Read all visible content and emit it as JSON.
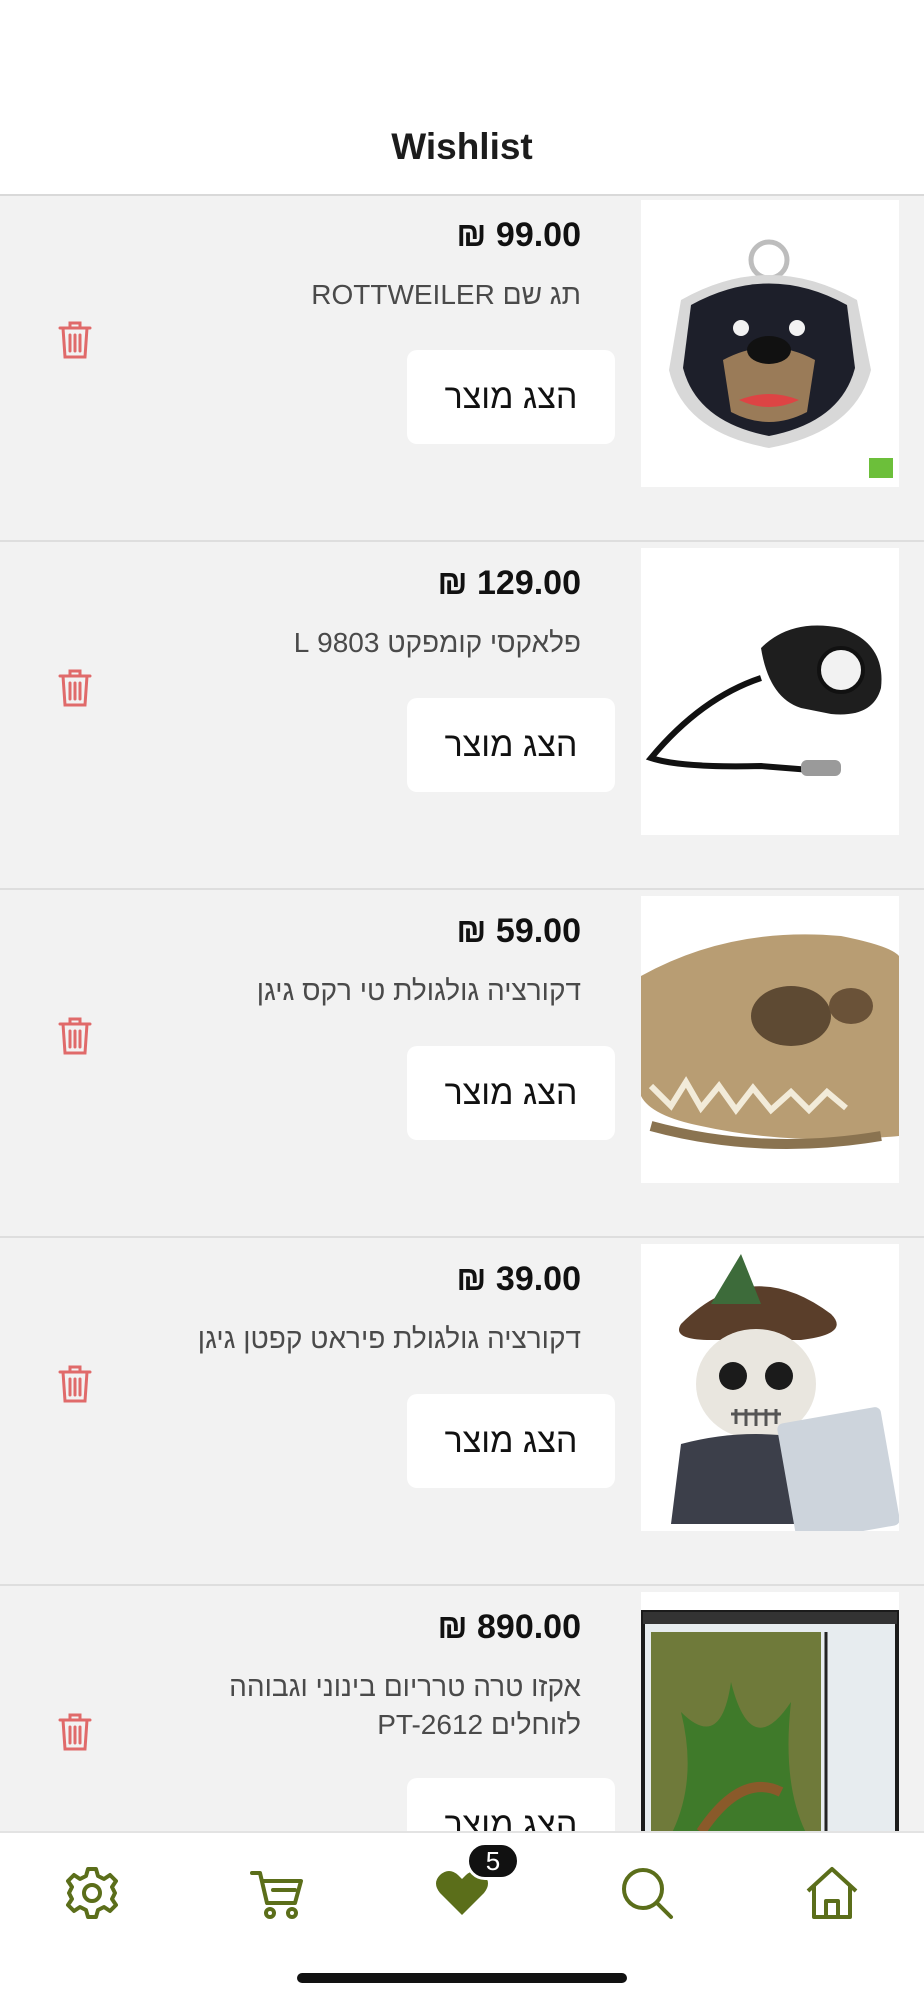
{
  "header": {
    "title": "Wishlist"
  },
  "items": [
    {
      "price": "₪ 99.00",
      "name": "תג שם ROTTWEILER",
      "button": "הצג מוצר",
      "image": "rottweiler-tag-image"
    },
    {
      "price": "₪ 129.00",
      "name": "פלאקסי קומפקט 9803 L",
      "button": "הצג מוצר",
      "image": "retractable-leash-image"
    },
    {
      "price": "₪ 59.00",
      "name": "דקורציה גולגולת טי רקס גיגן",
      "button": "הצג מוצר",
      "image": "trex-skull-image"
    },
    {
      "price": "₪ 39.00",
      "name": "דקורציה גולגולת פיראט קפטן גיגן",
      "button": "הצג מוצר",
      "image": "pirate-skull-image"
    },
    {
      "price": "₪ 890.00",
      "name": "אקזו טרה טרריום בינוני וגבוהה לזוחלים PT-2612",
      "button": "הצג מוצר",
      "image": "terrarium-image"
    }
  ],
  "nav": {
    "items": [
      "settings-icon",
      "cart-icon",
      "heart-icon",
      "search-icon",
      "home-icon"
    ],
    "wishlist_badge": "5",
    "accent_color": "#5b6e1a"
  },
  "colors": {
    "trash": "#e06a6a",
    "list_bg": "#f2f2f2"
  }
}
